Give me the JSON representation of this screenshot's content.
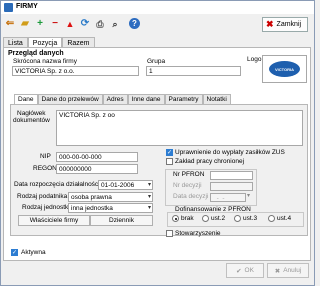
{
  "window": {
    "title": "FIRMY"
  },
  "toolbar": {
    "close_label": "Zamknij",
    "icons": [
      "back-icon",
      "folder-icon",
      "add-icon",
      "delete-icon",
      "warning-icon",
      "refresh-icon",
      "print-icon",
      "find-icon",
      "help-icon"
    ]
  },
  "tabs": [
    {
      "label": "Lista",
      "active": false
    },
    {
      "label": "Pozycja",
      "active": true
    },
    {
      "label": "Razem",
      "active": false
    }
  ],
  "overview": {
    "title": "Przegląd danych",
    "short_name_label": "Skrócona nazwa firmy",
    "short_name_value": "VICTORIA Sp. z o.o.",
    "group_label": "Grupa",
    "group_value": "1",
    "logo_label": "Logo",
    "logo_text": "VICTORIA"
  },
  "inner_tabs": [
    {
      "label": "Dane",
      "active": true
    },
    {
      "label": "Dane do przelewów",
      "active": false
    },
    {
      "label": "Adres",
      "active": false
    },
    {
      "label": "Inne dane",
      "active": false
    },
    {
      "label": "Parametry",
      "active": false
    },
    {
      "label": "Notatki",
      "active": false
    }
  ],
  "details": {
    "header_label_1": "Nagłówek",
    "header_label_2": "dokumentów",
    "header_value": "VICTORIA Sp. z oo",
    "nip_label": "NIP",
    "nip_value": "000-00-00-000",
    "regon_label": "REGON",
    "regon_value": "000000000",
    "start_date_label": "Data rozpoczęcia działalności",
    "start_date_value": "01-01-2006",
    "taxpayer_label": "Rodzaj podatnika",
    "taxpayer_value": "osoba prawna",
    "unit_label": "Rodzaj jednostki",
    "unit_value": "inna jednostka",
    "owners_button": "Właściciele firmy",
    "journal_button": "Dziennik"
  },
  "zus": {
    "entitled_label": "Uprawnienie do wypłaty zasiłków ZUS",
    "protected_label": "Zakład pracy chronionej",
    "pfron_no_label": "Nr PFRON",
    "decision_no_label": "Nr decyzji",
    "decision_date_label": "Data decyzji",
    "decision_date_value": "_-_-___",
    "funding_label": "Dofinansowanie z PFRON",
    "funding_options": [
      "brak",
      "ust.2",
      "ust.3",
      "ust.4"
    ],
    "funding_selected": "brak",
    "association_label": "Stowarzyszenie"
  },
  "footer": {
    "active_label": "Aktywna",
    "ok_label": "OK",
    "cancel_label": "Anuluj"
  }
}
